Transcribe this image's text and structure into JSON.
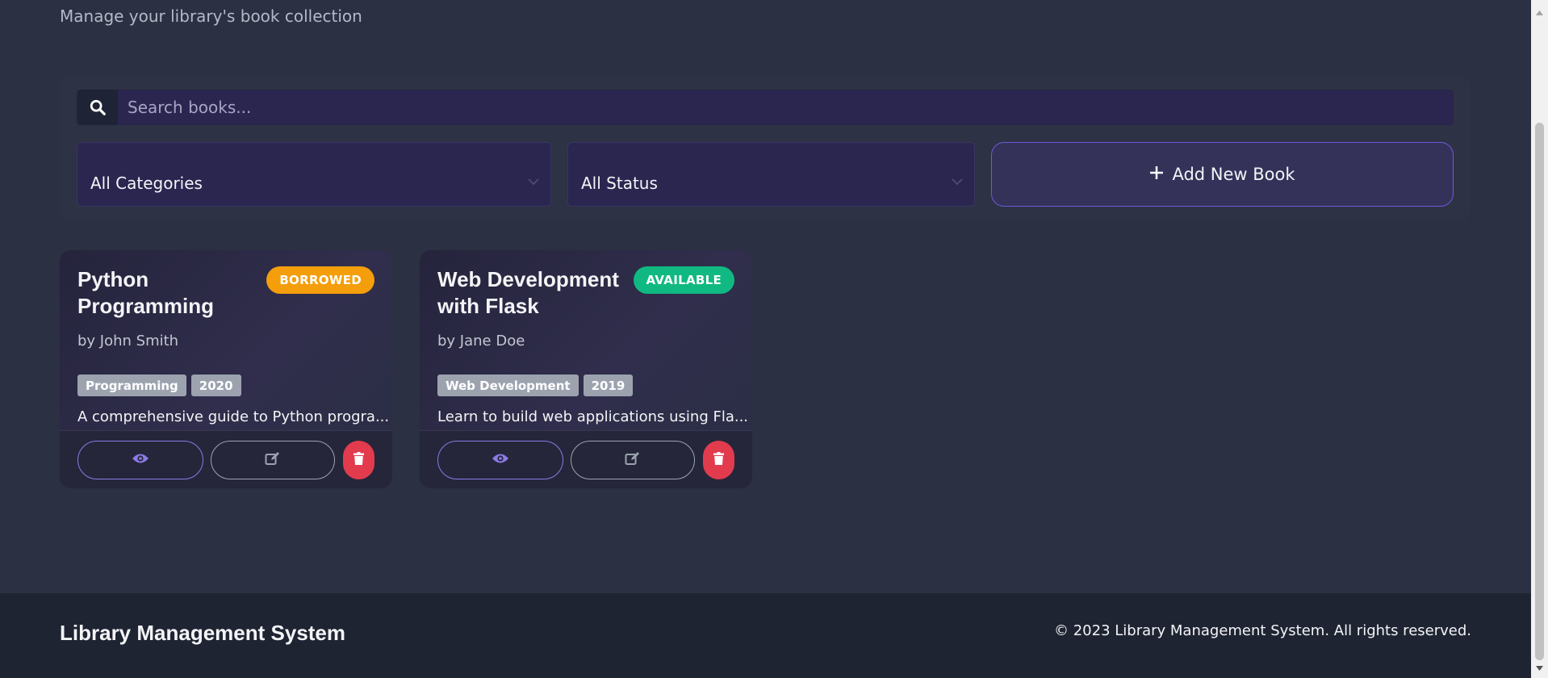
{
  "header": {
    "subtitle": "Manage your library's book collection"
  },
  "filters": {
    "search_placeholder": "Search books...",
    "category_selected": "All Categories",
    "status_selected": "All Status",
    "add_button_label": "Add New Book"
  },
  "books": [
    {
      "title": "Python Programming",
      "status": "BORROWED",
      "author": "by John Smith",
      "category": "Programming",
      "year": "2020",
      "description": "A comprehensive guide to Python progra..."
    },
    {
      "title": "Web Development with Flask",
      "status": "AVAILABLE",
      "author": "by Jane Doe",
      "category": "Web Development",
      "year": "2019",
      "description": "Learn to build web applications using Fla..."
    }
  ],
  "footer": {
    "brand": "Library Management System",
    "copyright": "© 2023 Library Management System. All rights reserved."
  },
  "colors": {
    "background": "#2b3042",
    "accent": "#6d5ad8",
    "borrowed": "#f59e0b",
    "available": "#10b981",
    "danger": "#e23b4e"
  }
}
